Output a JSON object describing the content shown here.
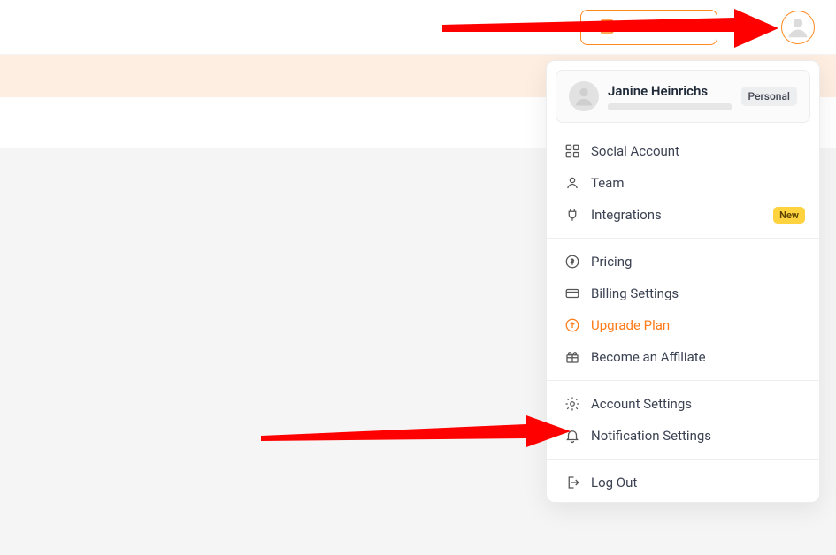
{
  "topbar": {
    "upgrade_label": "Upgrade"
  },
  "user": {
    "name": "Janine Heinrichs",
    "plan_badge": "Personal"
  },
  "menu": {
    "group1": [
      {
        "label": "Social Account",
        "icon": "grid-icon"
      },
      {
        "label": "Team",
        "icon": "person-icon"
      },
      {
        "label": "Integrations",
        "icon": "plug-icon",
        "new": "New"
      }
    ],
    "group2": [
      {
        "label": "Pricing",
        "icon": "dollar-icon"
      },
      {
        "label": "Billing Settings",
        "icon": "card-icon"
      },
      {
        "label": "Upgrade Plan",
        "icon": "upgrade-icon",
        "accent": true
      },
      {
        "label": "Become an Affiliate",
        "icon": "gift-icon"
      }
    ],
    "group3": [
      {
        "label": "Account Settings",
        "icon": "gear-icon"
      },
      {
        "label": "Notification Settings",
        "icon": "bell-icon"
      }
    ],
    "group4": [
      {
        "label": "Log Out",
        "icon": "logout-icon"
      }
    ]
  }
}
